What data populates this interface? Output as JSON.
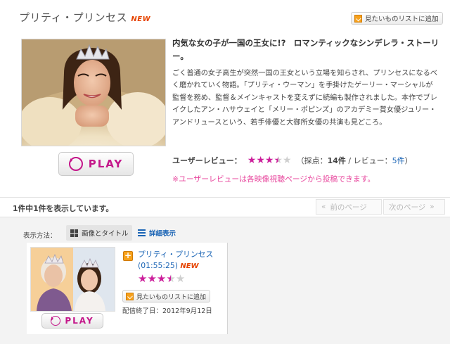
{
  "header": {
    "title": "プリティ・プリンセス",
    "new_badge": "NEW",
    "wishlist_label": "見たいものリストに追加"
  },
  "hero": {
    "play_label": "PLAY"
  },
  "description": {
    "headline": "内気な女の子が一国の王女に!?　ロマンティックなシンデレラ・ストーリー。",
    "body": "ごく普通の女子高生が突然一国の王女という立場を知らされ、プリンセスになるべく磨かれていく物語。「プリティ・ウーマン」を手掛けたゲーリー・マーシャルが監督を務め、監督＆メインキャストを変えずに続編も製作されました。本作でブレイクしたアン・ハサウェイと「メリー・ポピンズ」のアカデミー賞女優ジュリー・アンドリュースという、若手俳優と大御所女優の共演も見どころ。"
  },
  "review": {
    "label": "ユーザーレビュー：",
    "rating": 3.5,
    "rating_max": 5,
    "score_prefix": "（採点：",
    "score_value": "14件",
    "separator": " / レビュー：",
    "review_count": "5件",
    "suffix": "）",
    "note": "※ユーザーレビューは各映像視聴ページから投稿できます。"
  },
  "results": {
    "count_text": "1件中1件を表示しています。",
    "prev_label": "前のページ",
    "next_label": "次のページ"
  },
  "display": {
    "label": "表示方法：",
    "grid_tab_label": "画像とタイトル",
    "detail_tab_label": "詳細表示"
  },
  "item": {
    "title": "プリティ・プリンセス(01:55:25)",
    "new_badge": "NEW",
    "rating": 3.5,
    "wishlist_label": "見たいものリストに追加",
    "play_label": "PLAY",
    "expiry": "配信終了日：2012年9月12日"
  },
  "colors": {
    "accent_pink": "#c4178a",
    "link_blue": "#1a64b5",
    "new_orange": "#e64400",
    "note_pink": "#e8489e"
  }
}
